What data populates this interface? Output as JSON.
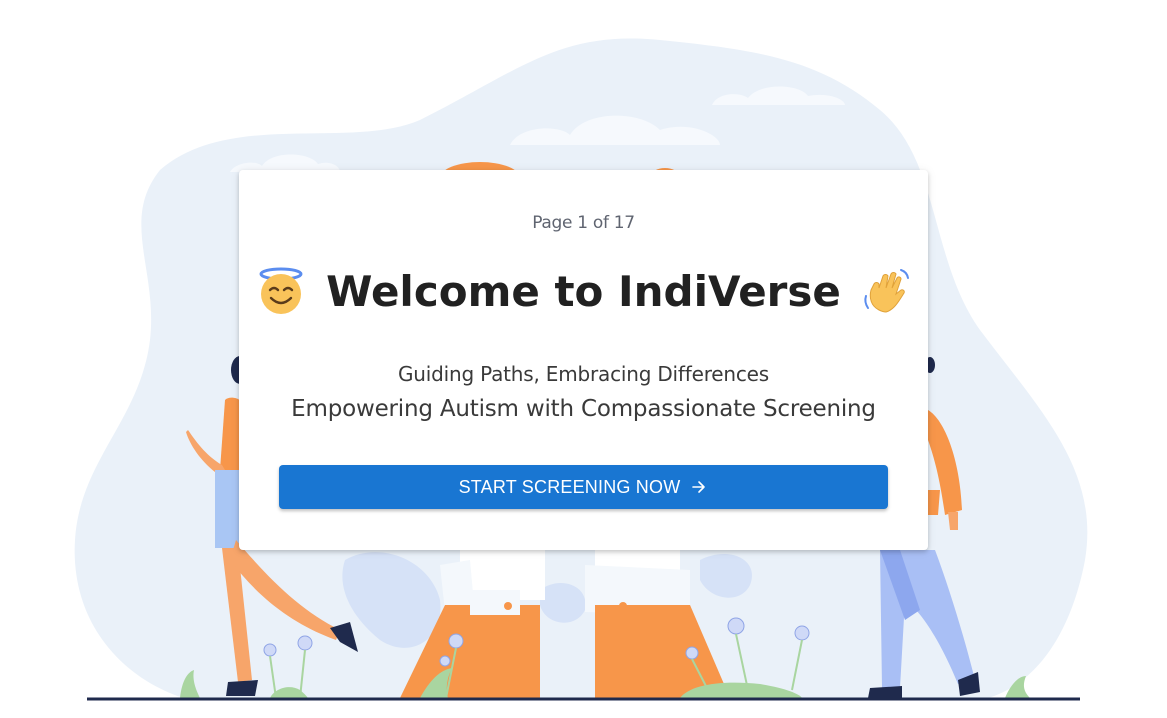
{
  "page_indicator": "Page 1 of 17",
  "title": "Welcome to IndiVerse",
  "title_icons": {
    "left": "smiling-face-with-halo-icon",
    "right": "waving-hand-icon"
  },
  "taglines": {
    "line1": "Guiding Paths, Embracing Differences",
    "line2": "Empowering Autism with Compassionate Screening"
  },
  "start_button": {
    "label": "START SCREENING NOW",
    "icon": "arrow-right-icon"
  },
  "colors": {
    "primary": "#1976d2",
    "blob": "#eaf1f9",
    "figure_orange": "#f7964a",
    "figure_blue": "#a9bff5",
    "ground_line": "#1f2a4d"
  }
}
